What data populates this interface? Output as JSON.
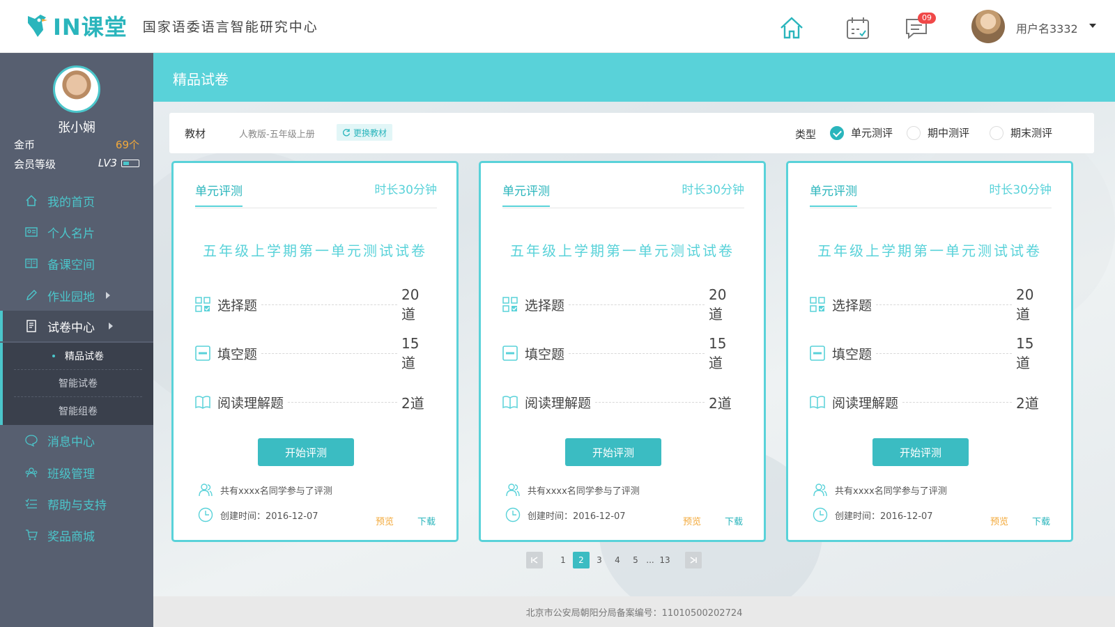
{
  "header": {
    "logo_text": "IN课堂",
    "logo_subtitle": "国家语委语言智能研究中心",
    "message_badge": "09",
    "username": "用户名3332"
  },
  "sidebar": {
    "profile_name": "张小娴",
    "gold_label": "金币",
    "gold_value": "69个",
    "level_label": "会员等级",
    "level_value": "LV3",
    "nav": [
      {
        "label": "我的首页",
        "icon": "home-icon"
      },
      {
        "label": "个人名片",
        "icon": "id-card-icon"
      },
      {
        "label": "备课空间",
        "icon": "book-open-icon"
      },
      {
        "label": "作业园地",
        "icon": "pencil-icon"
      },
      {
        "label": "试卷中心",
        "icon": "exam-paper-icon"
      },
      {
        "label": "消息中心",
        "icon": "chat-icon"
      },
      {
        "label": "班级管理",
        "icon": "class-group-icon"
      },
      {
        "label": "帮助与支持",
        "icon": "list-check-icon"
      },
      {
        "label": "奖品商城",
        "icon": "cart-icon"
      }
    ],
    "subnav": [
      {
        "label": "精品试卷"
      },
      {
        "label": "智能试卷"
      },
      {
        "label": "智能组卷"
      }
    ]
  },
  "page": {
    "title": "精品试卷"
  },
  "filter": {
    "textbook_label": "教材",
    "textbook_value": "人教版-五年级上册",
    "change_button": "更换教材",
    "type_label": "类型",
    "types": [
      "单元测评",
      "期中测评",
      "期末测评"
    ],
    "selected_type": "单元测评"
  },
  "cards": [
    {
      "tag": "单元评测",
      "duration": "时长30分钟",
      "title": "五年级上学期第一单元测试试卷",
      "questions": [
        {
          "name": "选择题",
          "count": "20道"
        },
        {
          "name": "填空题",
          "count": "15道"
        },
        {
          "name": "阅读理解题",
          "count": "2道"
        }
      ],
      "start_button": "开始评测",
      "participants": "共有xxxx名同学参与了评测",
      "created": "创建时间：2016-12-07",
      "preview": "预览",
      "download": "下载"
    },
    {
      "tag": "单元评测",
      "duration": "时长30分钟",
      "title": "五年级上学期第一单元测试试卷",
      "questions": [
        {
          "name": "选择题",
          "count": "20道"
        },
        {
          "name": "填空题",
          "count": "15道"
        },
        {
          "name": "阅读理解题",
          "count": "2道"
        }
      ],
      "start_button": "开始评测",
      "participants": "共有xxxx名同学参与了评测",
      "created": "创建时间：2016-12-07",
      "preview": "预览",
      "download": "下载"
    },
    {
      "tag": "单元评测",
      "duration": "时长30分钟",
      "title": "五年级上学期第一单元测试试卷",
      "questions": [
        {
          "name": "选择题",
          "count": "20道"
        },
        {
          "name": "填空题",
          "count": "15道"
        },
        {
          "name": "阅读理解题",
          "count": "2道"
        }
      ],
      "start_button": "开始评测",
      "participants": "共有xxxx名同学参与了评测",
      "created": "创建时间：2016-12-07",
      "preview": "预览",
      "download": "下载"
    }
  ],
  "pagination": {
    "pages": [
      "1",
      "2",
      "3",
      "4",
      "5",
      "...",
      "13"
    ],
    "current": "2"
  },
  "footer": {
    "text": "北京市公安局朝阳分局备案编号：110105002027​24"
  },
  "colors": {
    "accent": "#59d2d9",
    "accent_dark": "#2ab5bc",
    "sidebar_bg": "#575f70",
    "orange": "#f3a93a",
    "badge_red": "#f04848"
  }
}
